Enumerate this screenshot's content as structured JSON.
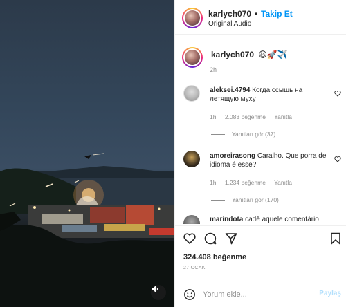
{
  "header": {
    "username": "karlych070",
    "separator": "•",
    "follow_label": "Takip Et",
    "audio": "Original Audio"
  },
  "caption": {
    "username": "karlych070",
    "text": "😆🚀✈️",
    "time": "2h"
  },
  "comments": [
    {
      "username": "aleksei.4794",
      "text": "Когда ссышь на летящую муху",
      "time": "1h",
      "likes": "2.083 beğenme",
      "reply_label": "Yanıtla",
      "replies_label": "Yanıtları gör (37)"
    },
    {
      "username": "amoreirasong",
      "text": "Caralho. Que porra de idioma é esse?",
      "time": "1h",
      "likes": "1.234 beğenme",
      "reply_label": "Yanıtla",
      "replies_label": "Yanıtları gör (170)"
    },
    {
      "username": "marindota",
      "text": "cadê aquele comentário"
    }
  ],
  "actions": {
    "like_icon": "heart-icon",
    "comment_icon": "comment-icon",
    "share_icon": "paper-plane-icon",
    "save_icon": "bookmark-icon"
  },
  "likes": "324.408 beğenme",
  "date": "27 OCAK",
  "comment_bar": {
    "placeholder": "Yorum ekle...",
    "share_label": "Paylaş"
  },
  "colors": {
    "accent": "#0095f6",
    "text": "#262626",
    "muted": "#8e8e8e"
  }
}
